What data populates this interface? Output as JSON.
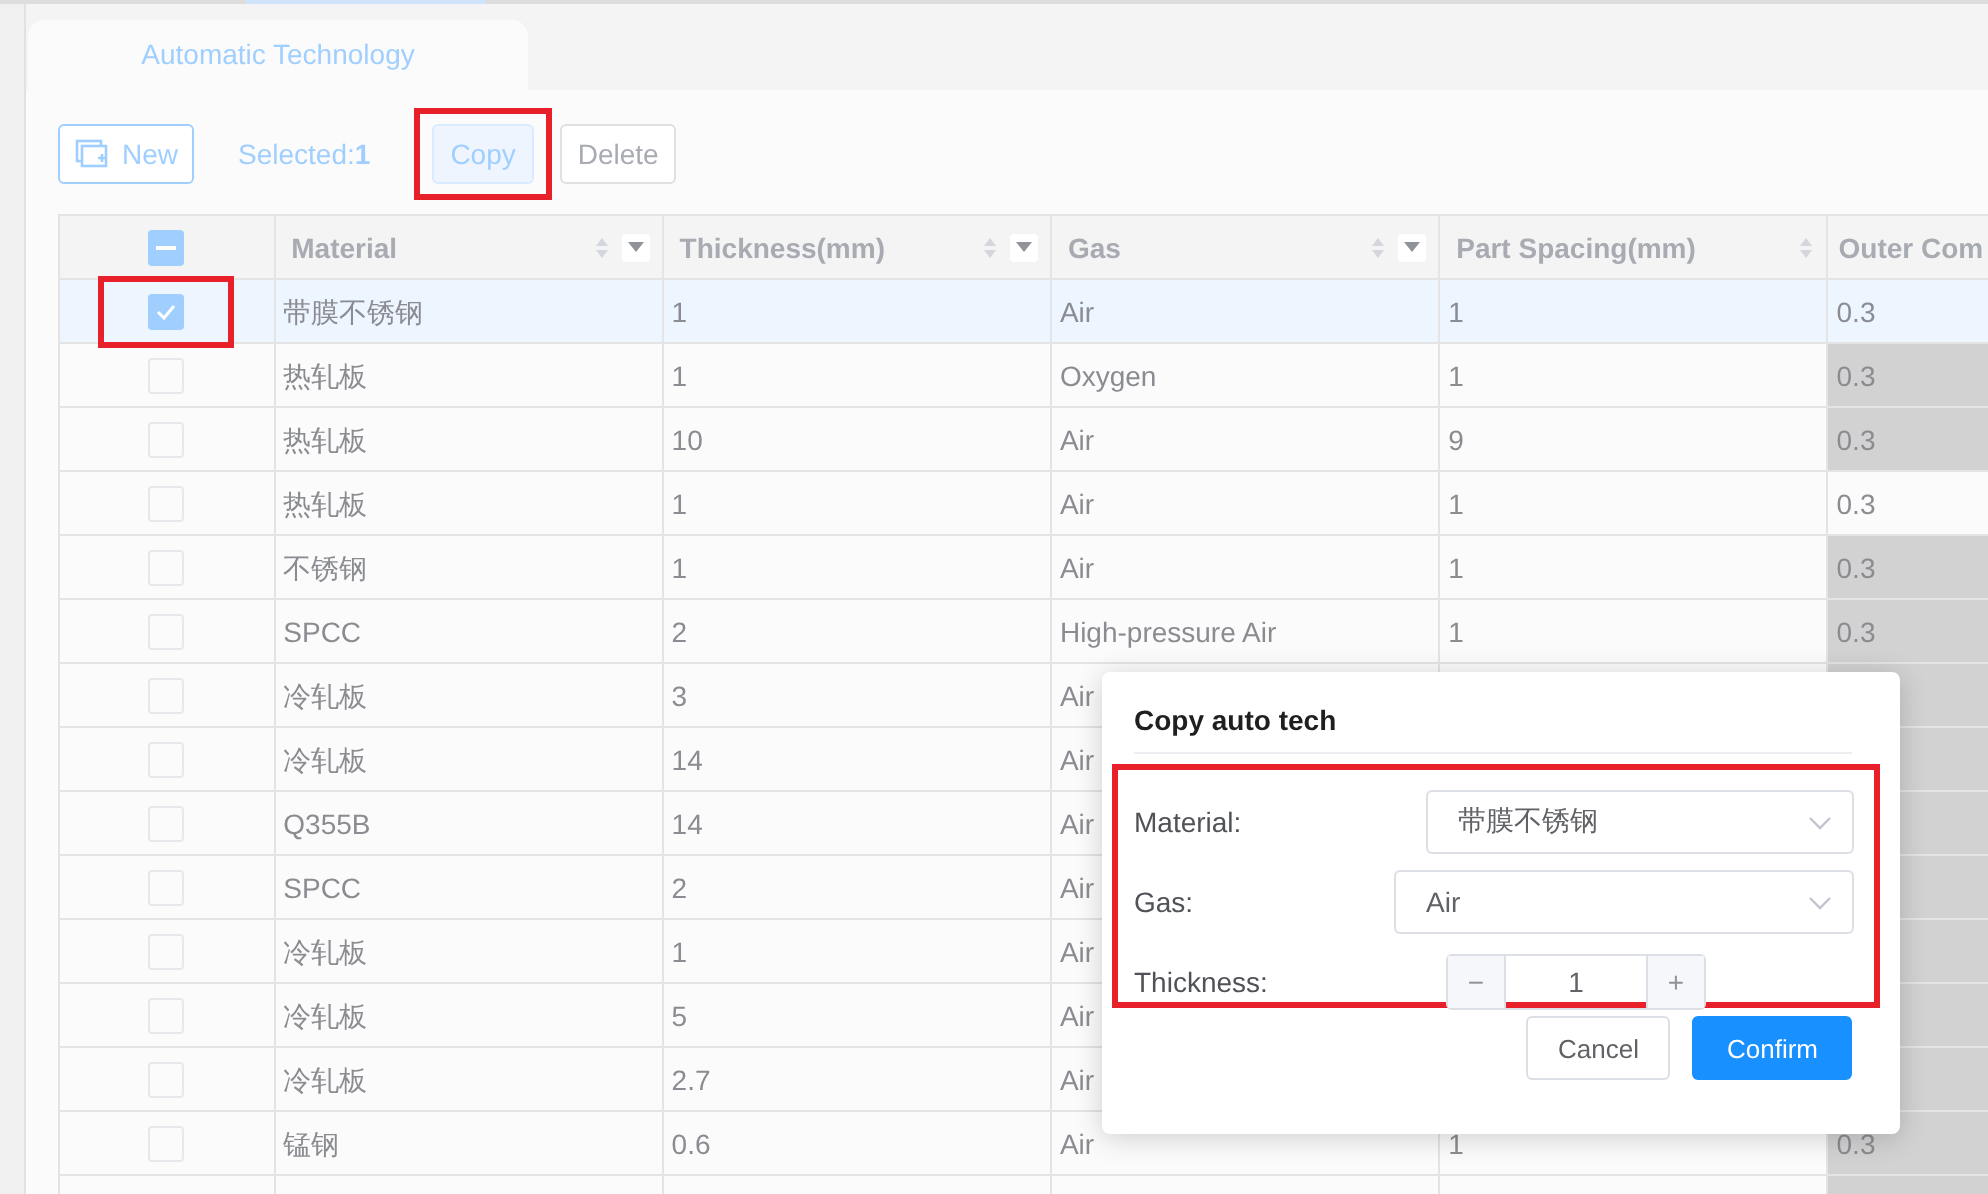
{
  "tabs": [
    {
      "label": "Automatic Technology"
    }
  ],
  "toolbar": {
    "new_label": "New",
    "selected_label": "Selected:",
    "selected_count": "1",
    "copy_label": "Copy",
    "copy_annotated": true,
    "delete_label": "Delete"
  },
  "table": {
    "select_all": {
      "indeterminate": true
    },
    "columns": [
      {
        "label": "Material",
        "sortable": true,
        "filter": true
      },
      {
        "label": "Thickness(mm)",
        "sortable": true,
        "filter": true
      },
      {
        "label": "Gas",
        "sortable": true,
        "filter": true
      },
      {
        "label": "Part Spacing(mm)",
        "sortable": true,
        "filter": false
      },
      {
        "label": "Outer Com",
        "sortable": false,
        "filter": false
      }
    ],
    "rows": [
      {
        "checked": true,
        "annotated": true,
        "material": "带膜不锈钢",
        "thickness": "1",
        "gas": "Air",
        "spacing": "1",
        "outer": "0.3",
        "greyed": false
      },
      {
        "checked": false,
        "annotated": false,
        "material": "热轧板",
        "thickness": "1",
        "gas": "Oxygen",
        "spacing": "1",
        "outer": "0.3",
        "greyed": true
      },
      {
        "checked": false,
        "annotated": false,
        "material": "热轧板",
        "thickness": "10",
        "gas": "Air",
        "spacing": "9",
        "outer": "0.3",
        "greyed": true
      },
      {
        "checked": false,
        "annotated": false,
        "material": "热轧板",
        "thickness": "1",
        "gas": "Air",
        "spacing": "1",
        "outer": "0.3",
        "greyed": false
      },
      {
        "checked": false,
        "annotated": false,
        "material": "不锈钢",
        "thickness": "1",
        "gas": "Air",
        "spacing": "1",
        "outer": "0.3",
        "greyed": true
      },
      {
        "checked": false,
        "annotated": false,
        "material": "SPCC",
        "thickness": "2",
        "gas": "High-pressure Air",
        "spacing": "1",
        "outer": "0.3",
        "greyed": true
      },
      {
        "checked": false,
        "annotated": false,
        "material": "冷轧板",
        "thickness": "3",
        "gas": "Air",
        "greyed": true
      },
      {
        "checked": false,
        "annotated": false,
        "material": "冷轧板",
        "thickness": "14",
        "gas": "Air",
        "greyed": true
      },
      {
        "checked": false,
        "annotated": false,
        "material": "Q355B",
        "thickness": "14",
        "gas": "Air",
        "greyed": true
      },
      {
        "checked": false,
        "annotated": false,
        "material": "SPCC",
        "thickness": "2",
        "gas": "Air",
        "greyed": true
      },
      {
        "checked": false,
        "annotated": false,
        "material": "冷轧板",
        "thickness": "1",
        "gas": "Air",
        "greyed": true
      },
      {
        "checked": false,
        "annotated": false,
        "material": "冷轧板",
        "thickness": "5",
        "gas": "Air",
        "greyed": true
      },
      {
        "checked": false,
        "annotated": false,
        "material": "冷轧板",
        "thickness": "2.7",
        "gas": "Air",
        "greyed": true
      },
      {
        "checked": false,
        "annotated": false,
        "material": "锰钢",
        "thickness": "0.6",
        "gas": "Air",
        "spacing": "1",
        "outer": "0.3",
        "greyed": true
      }
    ]
  },
  "dialog": {
    "title": "Copy auto tech",
    "annotated": true,
    "fields": [
      {
        "label": "Material:",
        "value": "带膜不锈钢",
        "kind": "select"
      },
      {
        "label": "Gas:",
        "value": "Air",
        "kind": "select"
      },
      {
        "label": "Thickness:",
        "value": "1",
        "kind": "number",
        "minus": "−",
        "plus": "+"
      }
    ],
    "buttons": [
      {
        "label": "Cancel",
        "kind": "default"
      },
      {
        "label": "Confirm",
        "kind": "primary"
      }
    ]
  }
}
